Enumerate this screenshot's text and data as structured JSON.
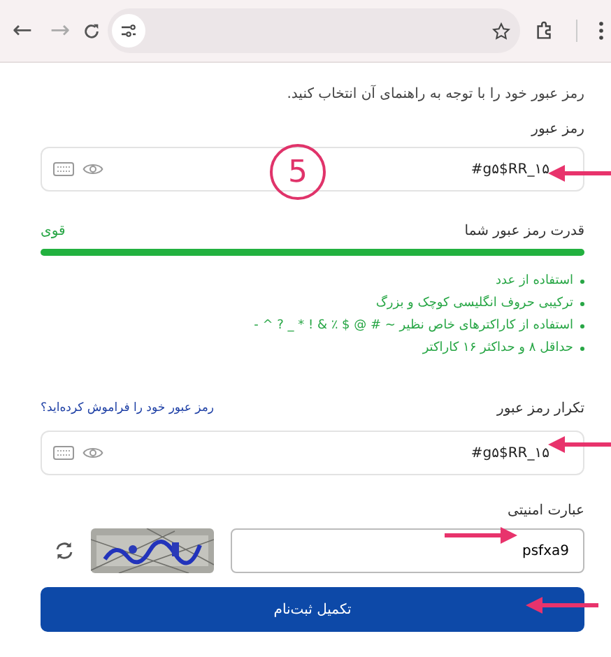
{
  "browser": {
    "back": "←",
    "forward": "→"
  },
  "instruction": "رمز عبور خود را با توجه به راهنمای آن انتخاب کنید.",
  "step_badge": "5",
  "password": {
    "label": "رمز عبور",
    "value": "#g۵$RR_۱۵"
  },
  "strength": {
    "label": "قدرت رمز عبور شما",
    "reading": "قوی",
    "level": 1
  },
  "rules": [
    {
      "text": "استفاده از عدد"
    },
    {
      "text": "ترکیبی حروف انگلیسی کوچک و بزرگ"
    },
    {
      "text": "استفاده از کاراکترهای خاص نظیر ~ # @ $ ٪ & ! * _ ? ^ -"
    },
    {
      "text": "حداقل ۸ و حداکثر ۱۶ کاراکتر"
    }
  ],
  "confirm": {
    "label": "تکرار رمز عبور",
    "forgot_link": "رمز عبور خود را فراموش کرده‌اید؟",
    "value": "#g۵$RR_۱۵"
  },
  "captcha": {
    "label": "عبارت امنیتی",
    "value": "psfxa9"
  },
  "submit": "تکمیل ثبت‌نام"
}
